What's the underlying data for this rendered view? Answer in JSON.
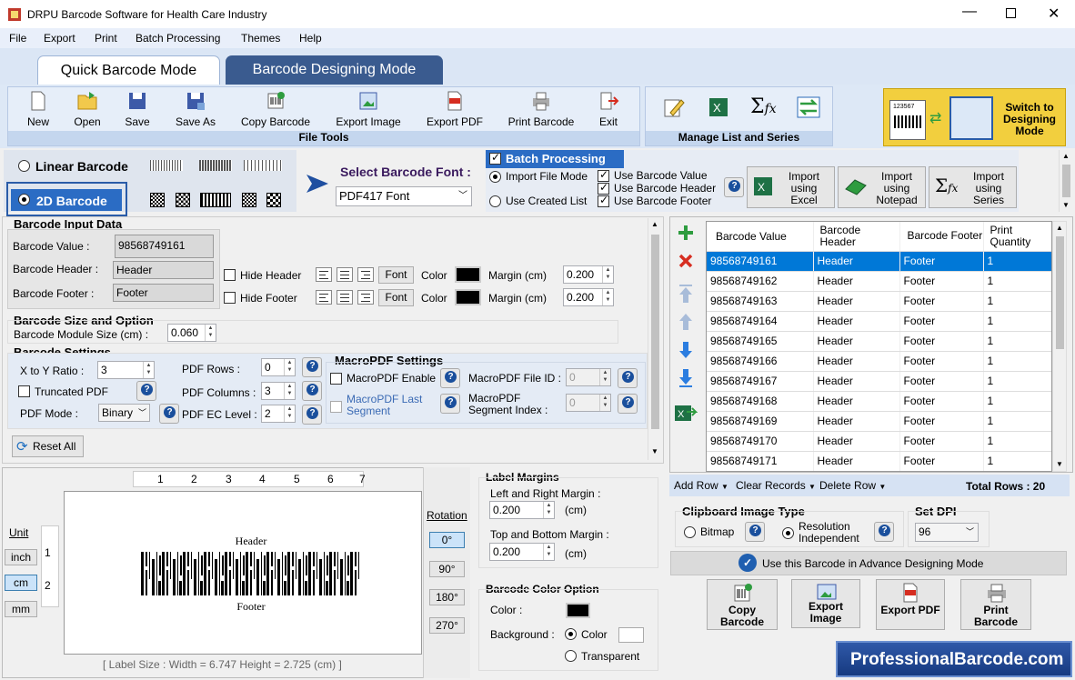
{
  "window": {
    "title": "DRPU Barcode Software for Health Care Industry"
  },
  "menu": [
    "File",
    "Export",
    "Print",
    "Batch Processing",
    "Themes",
    "Help"
  ],
  "tabs": {
    "quick": "Quick Barcode Mode",
    "designing": "Barcode Designing Mode"
  },
  "toolbar": {
    "buttons": [
      "New",
      "Open",
      "Save",
      "Save As",
      "Copy Barcode",
      "Export Image",
      "Export PDF",
      "Print Barcode",
      "Exit"
    ],
    "file_tools_label": "File Tools",
    "manage_label": "Manage List and Series",
    "switch_label": "Switch to Designing Mode",
    "switch_preview_num": "123567"
  },
  "barcode_type": {
    "linear": "Linear Barcode",
    "twod": "2D Barcode"
  },
  "font": {
    "label": "Select Barcode Font :",
    "value": "PDF417 Font"
  },
  "batch": {
    "title": "Batch Processing",
    "import_file_mode": "Import File Mode",
    "use_created_list": "Use Created List",
    "use_value": "Use Barcode Value",
    "use_header": "Use Barcode Header",
    "use_footer": "Use Barcode Footer",
    "import_excel": "Import using Excel",
    "import_notepad": "Import using Notepad",
    "import_series": "Import using Series"
  },
  "input": {
    "title": "Barcode Input Data",
    "value_label": "Barcode Value :",
    "value": "98568749161",
    "header_label": "Barcode Header :",
    "header": "Header",
    "footer_label": "Barcode Footer :",
    "footer": "Footer",
    "hide_header": "Hide Header",
    "hide_footer": "Hide Footer",
    "font_btn": "Font",
    "color": "Color",
    "margin_label": "Margin (cm)",
    "header_margin": "0.200",
    "footer_margin": "0.200"
  },
  "size": {
    "title": "Barcode Size and Option",
    "module_label": "Barcode Module Size (cm) :",
    "module_value": "0.060"
  },
  "settings": {
    "title": "Barcode Settings",
    "xy_label": "X to Y Ratio :",
    "xy_value": "3",
    "truncated": "Truncated PDF",
    "mode_label": "PDF Mode :",
    "mode_value": "Binary",
    "rows_label": "PDF Rows :",
    "rows_value": "0",
    "cols_label": "PDF Columns :",
    "cols_value": "3",
    "ec_label": "PDF EC Level :",
    "ec_value": "2",
    "macro_title": "MacroPDF Settings",
    "macro_enable": "MacroPDF Enable",
    "macro_last": "MacroPDF Last Segment",
    "file_id_label": "MacroPDF File ID :",
    "file_id_value": "0",
    "seg_label": "MacroPDF Segment Index :",
    "seg_value": "0",
    "reset": "Reset All"
  },
  "preview": {
    "ruler_ticks": [
      "1",
      "2",
      "3",
      "4",
      "5",
      "6",
      "7"
    ],
    "vruler_ticks": [
      "1",
      "2"
    ],
    "unit_label": "Unit",
    "units": [
      "inch",
      "cm",
      "mm"
    ],
    "header": "Header",
    "footer": "Footer",
    "label_size": "[ Label Size : Width = 6.747  Height = 2.725 (cm) ]",
    "rotation_label": "Rotation",
    "rotations": [
      "0°",
      "90°",
      "180°",
      "270°"
    ]
  },
  "margins": {
    "title": "Label Margins",
    "lr_label": "Left and Right Margin :",
    "lr_value": "0.200",
    "tb_label": "Top and Bottom Margin :",
    "tb_value": "0.200",
    "unit": "(cm)"
  },
  "color_option": {
    "title": "Barcode Color Option",
    "color_label": "Color :",
    "bg_label": "Background :",
    "color": "Color",
    "transparent": "Transparent"
  },
  "table": {
    "headers": [
      "Barcode Value",
      "Barcode Header",
      "Barcode Footer",
      "Print Quantity"
    ],
    "rows": [
      [
        "98568749161",
        "Header",
        "Footer",
        "1"
      ],
      [
        "98568749162",
        "Header",
        "Footer",
        "1"
      ],
      [
        "98568749163",
        "Header",
        "Footer",
        "1"
      ],
      [
        "98568749164",
        "Header",
        "Footer",
        "1"
      ],
      [
        "98568749165",
        "Header",
        "Footer",
        "1"
      ],
      [
        "98568749166",
        "Header",
        "Footer",
        "1"
      ],
      [
        "98568749167",
        "Header",
        "Footer",
        "1"
      ],
      [
        "98568749168",
        "Header",
        "Footer",
        "1"
      ],
      [
        "98568749169",
        "Header",
        "Footer",
        "1"
      ],
      [
        "98568749170",
        "Header",
        "Footer",
        "1"
      ],
      [
        "98568749171",
        "Header",
        "Footer",
        "1"
      ]
    ],
    "add_row": "Add Row",
    "clear_records": "Clear Records",
    "delete_row": "Delete Row",
    "total_rows": "Total Rows : 20"
  },
  "clipboard": {
    "title": "Clipboard Image Type",
    "bitmap": "Bitmap",
    "resolution": "Resolution Independent",
    "dpi_label": "Set DPI",
    "dpi_value": "96"
  },
  "advance": {
    "label": "Use this Barcode in Advance Designing Mode"
  },
  "actions": [
    "Copy Barcode",
    "Export Image",
    "Export PDF",
    "Print Barcode"
  ],
  "brand": "ProfessionalBarcode.com",
  "colors": {
    "accent": "#0a4a9c",
    "selected_row": "#0078d7",
    "brand_bg": "#1f3f8f"
  }
}
